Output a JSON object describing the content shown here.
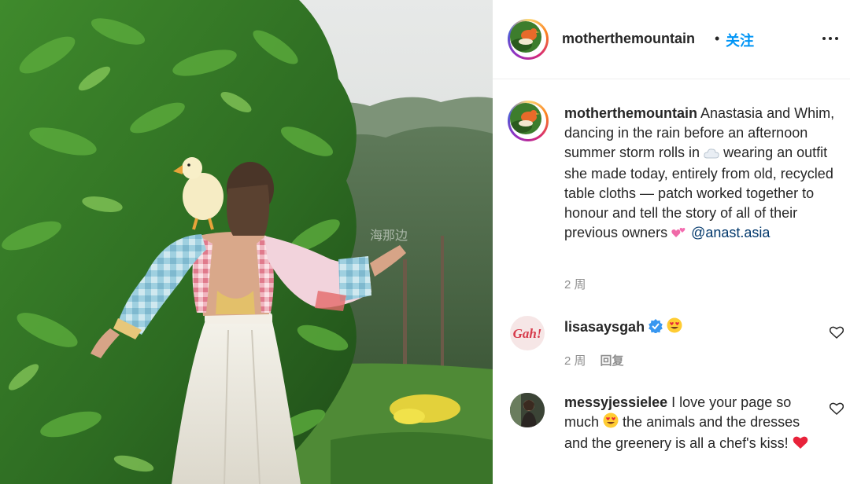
{
  "header": {
    "username": "motherthemountain",
    "dot": "•",
    "follow_label": "关注",
    "more_icon": "more-horizontal-icon"
  },
  "caption": {
    "username": "motherthemountain",
    "text_1": "Anastasia and Whim, dancing in the rain before an afternoon summer storm rolls in",
    "emoji_1": "cloud-emoji",
    "text_2": "wearing an outfit she made today, entirely from old, recycled table cloths — patch worked together to honour and tell the story of all of their previous owners",
    "emoji_2": "two-hearts-emoji",
    "mention": "@anast.asia",
    "time": "2 周"
  },
  "comments": [
    {
      "username": "lisasaysgah",
      "avatar_text": "Gah!",
      "verified": true,
      "emoji": "heart-eyes-emoji",
      "time": "2 周",
      "reply_label": "回复"
    },
    {
      "username": "messyjessielee",
      "text_1": "I love your page so much",
      "emoji_1": "heart-eyes-emoji",
      "text_2": "the animals and the dresses and the greenery is all a chef's kiss!",
      "emoji_2": "red-heart-emoji"
    }
  ],
  "colors": {
    "follow": "#0095f6",
    "mention": "#00376b",
    "verified": "#3897f0",
    "meta": "#8e8e8e"
  }
}
